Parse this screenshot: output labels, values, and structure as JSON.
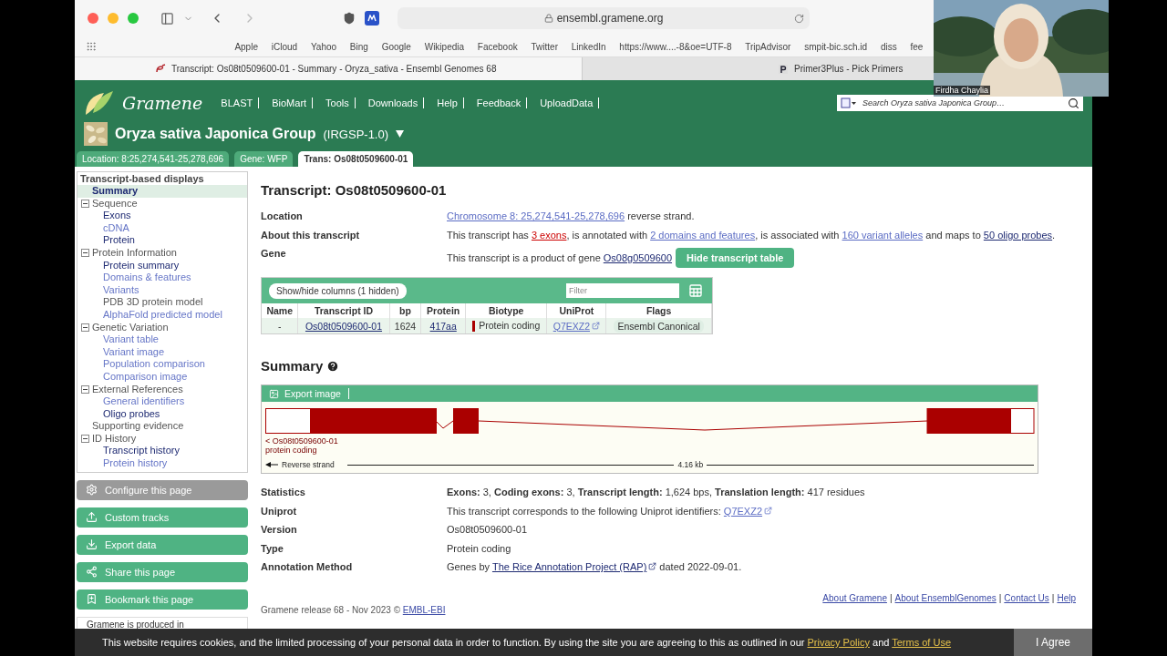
{
  "browser": {
    "url": "ensembl.gramene.org",
    "bookmarks": [
      "Apple",
      "iCloud",
      "Yahoo",
      "Bing",
      "Google",
      "Wikipedia",
      "Facebook",
      "Twitter",
      "LinkedIn",
      "https://www....-8&oe=UTF-8",
      "TripAdvisor",
      "smpit-bic.sch.id",
      "diss",
      "fee"
    ],
    "tabs": [
      {
        "title": "Transcript: Os08t0509600-01 - Summary - Oryza_sativa - Ensembl Genomes 68",
        "selected": true
      },
      {
        "title": "Primer3Plus - Pick Primers",
        "selected": false
      }
    ]
  },
  "header": {
    "logo": "Gramene",
    "nav": [
      "BLAST",
      "BioMart",
      "Tools",
      "Downloads",
      "Help",
      "Feedback",
      "UploadData"
    ],
    "search": {
      "placeholder": "Search Oryza sativa Japonica Group…"
    },
    "species": "Oryza sativa Japonica Group",
    "assembly": "(IRGSP-1.0)",
    "location_tabs": [
      {
        "label": "Location: 8:25,274,541-25,278,696",
        "selected": false
      },
      {
        "label": "Gene: WFP",
        "selected": false
      },
      {
        "label": "Trans: Os08t0509600-01",
        "selected": true
      }
    ]
  },
  "sidebar": {
    "title": "Transcript-based displays",
    "items": [
      {
        "label": "Summary",
        "kind": "visited",
        "selected": true
      },
      {
        "label": "Sequence",
        "kind": "plain",
        "selected": false,
        "expanded": true,
        "children": [
          {
            "label": "Exons",
            "kind": "visited",
            "selected": false
          },
          {
            "label": "cDNA",
            "kind": "link",
            "selected": false
          },
          {
            "label": "Protein",
            "kind": "visited",
            "selected": false
          }
        ]
      },
      {
        "label": "Protein Information",
        "kind": "plain",
        "selected": false,
        "expanded": true,
        "children": [
          {
            "label": "Protein summary",
            "kind": "visited",
            "selected": false
          },
          {
            "label": "Domains & features",
            "kind": "link",
            "selected": false
          },
          {
            "label": "Variants",
            "kind": "link",
            "selected": false
          },
          {
            "label": "PDB 3D protein model",
            "kind": "plain",
            "selected": false
          },
          {
            "label": "AlphaFold predicted model",
            "kind": "link",
            "selected": false
          }
        ]
      },
      {
        "label": "Genetic Variation",
        "kind": "plain",
        "selected": false,
        "expanded": true,
        "children": [
          {
            "label": "Variant table",
            "kind": "link",
            "selected": false
          },
          {
            "label": "Variant image",
            "kind": "link",
            "selected": false
          },
          {
            "label": "Population comparison",
            "kind": "link",
            "selected": false
          },
          {
            "label": "Comparison image",
            "kind": "link",
            "selected": false
          }
        ]
      },
      {
        "label": "External References",
        "kind": "plain",
        "selected": false,
        "expanded": true,
        "children": [
          {
            "label": "General identifiers",
            "kind": "link",
            "selected": false
          },
          {
            "label": "Oligo probes",
            "kind": "visited",
            "selected": false
          }
        ]
      },
      {
        "label": "Supporting evidence",
        "kind": "plain",
        "selected": false
      },
      {
        "label": "ID History",
        "kind": "plain",
        "selected": false,
        "expanded": true,
        "children": [
          {
            "label": "Transcript history",
            "kind": "visited",
            "selected": false
          },
          {
            "label": "Protein history",
            "kind": "link",
            "selected": false
          }
        ]
      }
    ],
    "buttons": [
      {
        "label": "Configure this page",
        "kind": "configure"
      },
      {
        "label": "Custom tracks",
        "kind": "tracks"
      },
      {
        "label": "Export data",
        "kind": "export"
      },
      {
        "label": "Share this page",
        "kind": "share"
      },
      {
        "label": "Bookmark this page",
        "kind": "bookmark"
      }
    ],
    "note": "Gramene is produced in"
  },
  "main": {
    "title": "Transcript: Os08t0509600-01",
    "fields": [
      {
        "label": "Location",
        "value": [
          {
            "kind": "link",
            "text": "Chromosome 8: 25,274,541-25,278,696"
          },
          {
            "kind": "text",
            "text": " reverse strand."
          }
        ]
      },
      {
        "label": "About this transcript",
        "value": [
          {
            "kind": "text",
            "text": "This transcript has "
          },
          {
            "kind": "hover",
            "text": "3 exons"
          },
          {
            "kind": "text",
            "text": ", is annotated with "
          },
          {
            "kind": "link",
            "text": "2 domains and features"
          },
          {
            "kind": "text",
            "text": ", is associated with "
          },
          {
            "kind": "link",
            "text": "160 variant alleles"
          },
          {
            "kind": "text",
            "text": " and maps to "
          },
          {
            "kind": "visited",
            "text": "50 oligo probes"
          },
          {
            "kind": "text",
            "text": "."
          }
        ]
      },
      {
        "label": "Gene",
        "value": [
          {
            "kind": "text",
            "text": "This transcript is a product of gene "
          },
          {
            "kind": "visited",
            "text": "Os08g0509600"
          }
        ],
        "button": "Hide transcript table"
      }
    ],
    "table": {
      "columns_button": "Show/hide columns (1 hidden)",
      "filter": {
        "placeholder": "Filter"
      },
      "columns": [
        "Name",
        "Transcript ID",
        "bp",
        "Protein",
        "Biotype",
        "UniProt",
        "Flags"
      ],
      "rows": [
        [
          {
            "kind": "text",
            "text": "-"
          },
          {
            "kind": "visited",
            "text": "Os08t0509600-01"
          },
          {
            "kind": "text",
            "text": "1624"
          },
          {
            "kind": "visited",
            "text": "417aa"
          },
          {
            "kind": "biotype",
            "text": "Protein coding",
            "color": "#aa0000"
          },
          {
            "kind": "extlink",
            "text": "Q7EXZ2"
          },
          {
            "kind": "badge",
            "text": "Ensembl Canonical"
          }
        ]
      ]
    },
    "summary": {
      "title": "Summary",
      "export_button": "Export image",
      "transcript_label": "< Os08t0509600-01",
      "biotype": "protein coding",
      "strand": "Reverse strand",
      "scale": "4.16 kb"
    },
    "stats": [
      {
        "label": "Statistics",
        "value": [
          {
            "kind": "text",
            "text": "**Exons:** 3, **Coding exons:** 3, **Transcript length:** 1,624 bps, **Translation length:** 417 residues"
          }
        ]
      },
      {
        "label": "Uniprot",
        "value": [
          {
            "kind": "text",
            "text": "This transcript corresponds to the following Uniprot identifiers: "
          },
          {
            "kind": "extlink",
            "text": "Q7EXZ2"
          }
        ]
      },
      {
        "label": "Version",
        "value": [
          {
            "kind": "text",
            "text": "Os08t0509600-01"
          }
        ]
      },
      {
        "label": "Type",
        "value": [
          {
            "kind": "text",
            "text": "Protein coding"
          }
        ]
      },
      {
        "label": "Annotation Method",
        "value": [
          {
            "kind": "text",
            "text": "Genes by "
          },
          {
            "kind": "extvisited",
            "text": "The Rice Annotation Project (RAP)"
          },
          {
            "kind": "text",
            "text": " dated 2022-09-01."
          }
        ]
      }
    ],
    "footer": {
      "separator": "|",
      "links": [
        "About Gramene",
        "About EnsemblGenomes",
        "Contact Us",
        "Help"
      ],
      "release": "Gramene release 68 - Nov 2023 © ",
      "release_link": "EMBL-EBI"
    }
  },
  "cookie_bar": {
    "text": "This website requires cookies, and the limited processing of your personal data in order to function. By using the site you are agreeing to this as outlined in our ",
    "privacy": "Privacy Policy",
    "and": " and ",
    "terms": "Terms of Use",
    "button": "I Agree"
  },
  "video": {
    "kind": "picture",
    "name": "Firdha Chaylia"
  }
}
